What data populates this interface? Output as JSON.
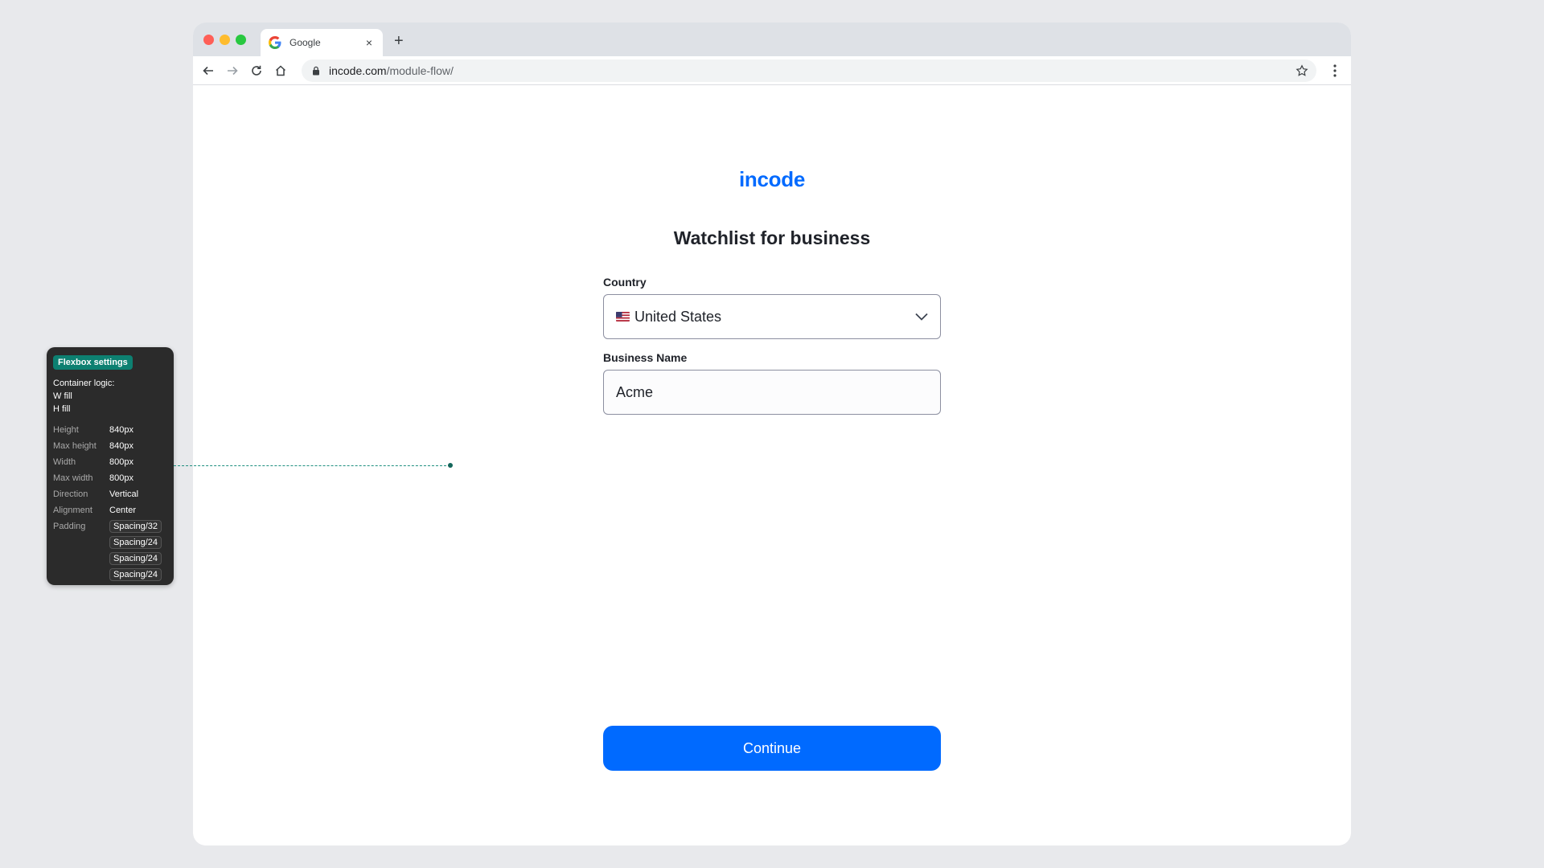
{
  "browser": {
    "tab_title": "Google",
    "tab_close": "×",
    "new_tab": "+",
    "url_host": "incode.com",
    "url_path": "/module-flow/"
  },
  "page": {
    "logo": "incode",
    "title": "Watchlist for business",
    "country": {
      "label": "Country",
      "value": "United States"
    },
    "business_name": {
      "label": "Business Name",
      "value": "Acme"
    },
    "continue_label": "Continue"
  },
  "flexbox_panel": {
    "tag": "Flexbox settings",
    "container_logic": [
      "Container logic:",
      "W fill",
      "H fill"
    ],
    "rows": [
      {
        "key": "Height",
        "value": "840px"
      },
      {
        "key": "Max height",
        "value": "840px"
      },
      {
        "key": "Width",
        "value": "800px"
      },
      {
        "key": "Max width",
        "value": "800px"
      },
      {
        "key": "Direction",
        "value": "Vertical"
      },
      {
        "key": "Alignment",
        "value": "Center"
      }
    ],
    "padding_key": "Padding",
    "padding": [
      "Spacing/32",
      "Spacing/24",
      "Spacing/24",
      "Spacing/24"
    ]
  },
  "colors": {
    "brand": "#006aff",
    "annotation_teal": "#0d8071"
  }
}
